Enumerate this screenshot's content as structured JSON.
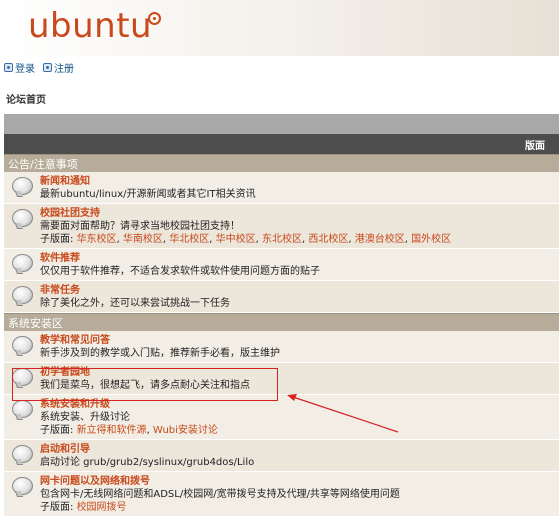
{
  "header": {
    "logo_text": "ubuntu"
  },
  "login_bar": {
    "login": "登录",
    "register": "注册"
  },
  "breadcrumb": "论坛首页",
  "table_header": {
    "right_label": "版面"
  },
  "categories": [
    {
      "name": "公告/注意事项",
      "forums": [
        {
          "title": "新闻和通知",
          "desc": "最新ubuntu/linux/开源新闻或者其它IT相关资讯",
          "sub_label": "",
          "subs": []
        },
        {
          "title": "校园社团支持",
          "desc": "需要面对面帮助？请寻求当地校园社团支持！",
          "sub_label": "子版面:",
          "subs": [
            "华东校区",
            "华南校区",
            "华北校区",
            "华中校区",
            "东北校区",
            "西北校区",
            "港澳台校区",
            "国外校区"
          ]
        },
        {
          "title": "软件推荐",
          "desc": "仅仅用于软件推荐，不适合发求软件或软件使用问题方面的贴子",
          "sub_label": "",
          "subs": []
        },
        {
          "title": "非常任务",
          "desc": "除了美化之外，还可以来尝试挑战一下任务",
          "sub_label": "",
          "subs": []
        }
      ]
    },
    {
      "name": "系统安装区",
      "forums": [
        {
          "title": "教学和常见问答",
          "desc": "新手涉及到的教学或入门贴，推荐新手必看，版主维护",
          "sub_label": "",
          "subs": []
        },
        {
          "title": "初学者园地",
          "desc": "我们是菜鸟，很想起飞，请多点耐心关注和指点",
          "sub_label": "",
          "subs": []
        },
        {
          "title": "系统安装和升级",
          "desc": "系统安装、升级讨论",
          "sub_label": "子版面:",
          "subs": [
            "新立得和软件源",
            "Wubi安装讨论"
          ]
        },
        {
          "title": "启动和引导",
          "desc": "启动讨论 grub/grub2/syslinux/grub4dos/Lilo",
          "sub_label": "",
          "subs": []
        },
        {
          "title": "网卡问题以及网络和拨号",
          "desc": "包含网卡/无线网络问题和ADSL/校园网/宽带拨号支持及代理/共享等网络使用问题",
          "sub_label": "子版面:",
          "subs": [
            "校园网拨号"
          ]
        }
      ]
    }
  ],
  "colors": {
    "accent": "#c8491b",
    "category_bar": "#b7ac9a",
    "annotation": "#d62222"
  }
}
